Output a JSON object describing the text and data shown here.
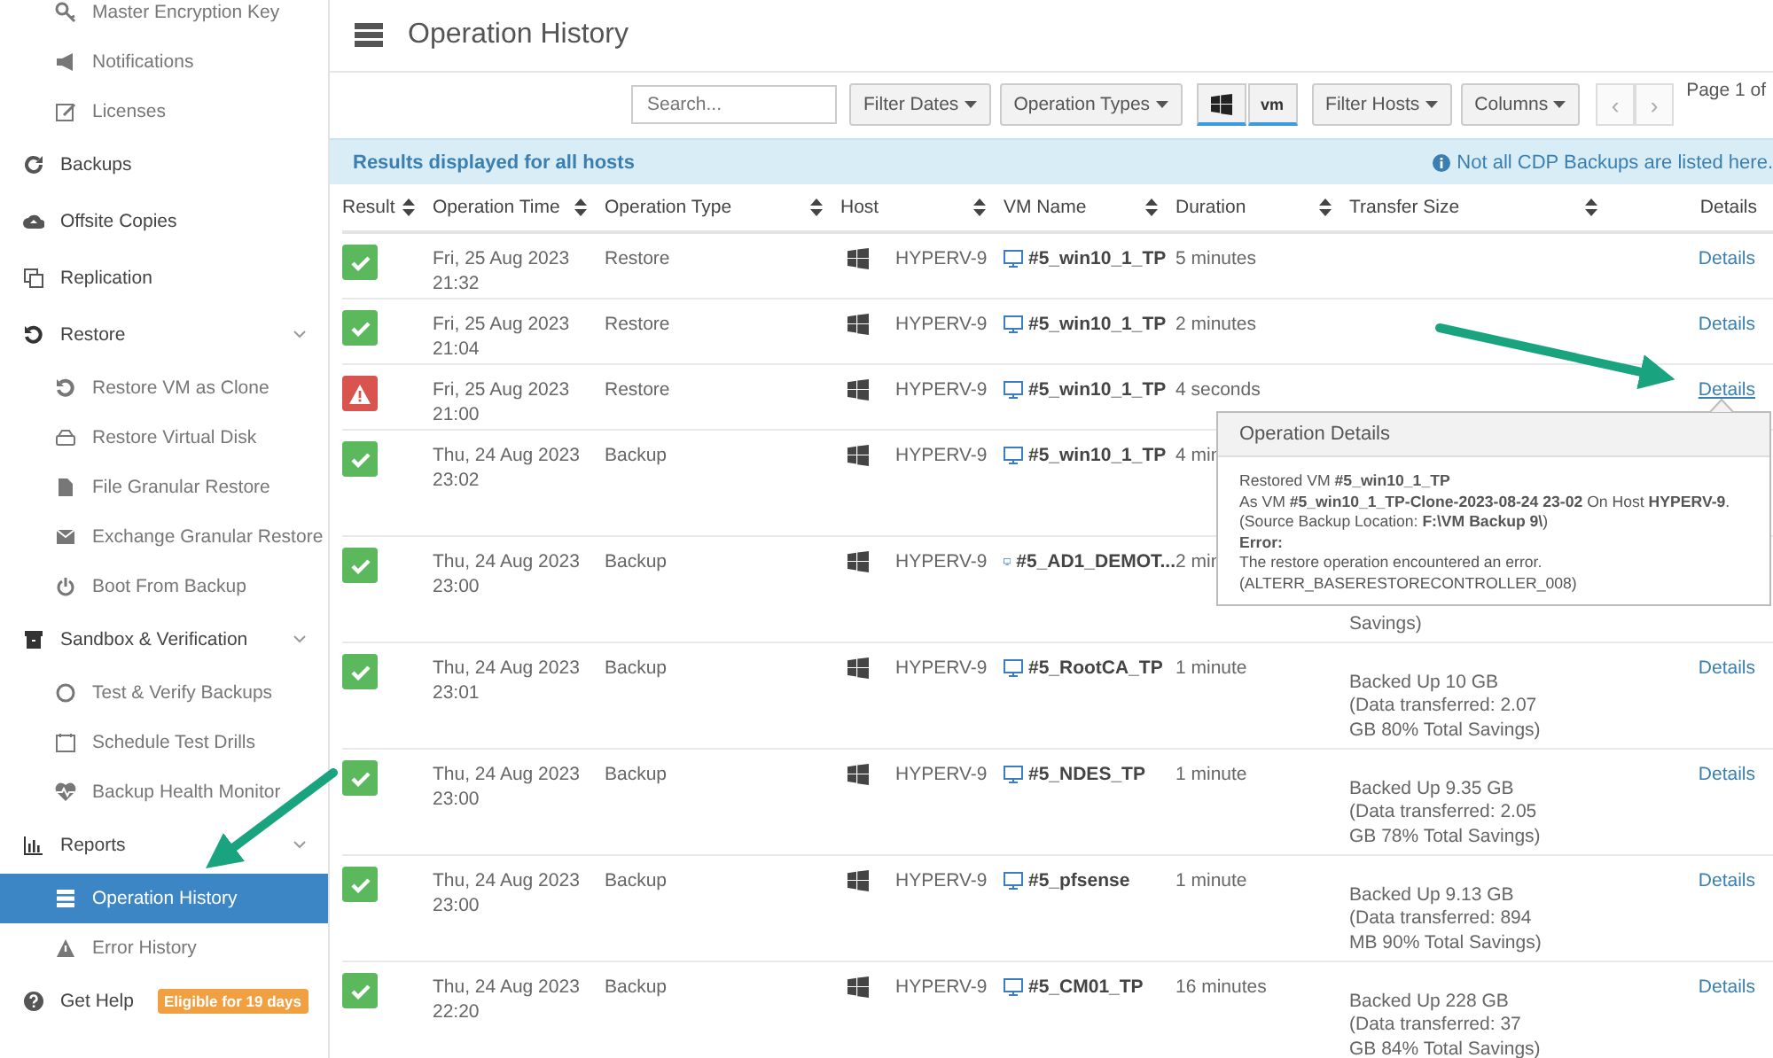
{
  "sidebar": {
    "settings_children": [
      {
        "label": "Master Encryption Key",
        "selected": false
      },
      {
        "label": "Notifications",
        "selected": false
      },
      {
        "label": "Licenses",
        "selected": false
      }
    ],
    "items": [
      {
        "label": "Backups",
        "selected": false
      },
      {
        "label": "Offsite Copies",
        "selected": false
      },
      {
        "label": "Replication",
        "selected": false
      },
      {
        "label": "Restore",
        "selected": false,
        "expanded": true,
        "children": [
          {
            "label": "Restore VM as Clone",
            "selected": false
          },
          {
            "label": "Restore Virtual Disk",
            "selected": false
          },
          {
            "label": "File Granular Restore",
            "selected": false
          },
          {
            "label": "Exchange Granular Restore",
            "selected": false
          },
          {
            "label": "Boot From Backup",
            "selected": false
          }
        ]
      },
      {
        "label": "Sandbox & Verification",
        "selected": false,
        "expanded": true,
        "children": [
          {
            "label": "Test & Verify Backups",
            "selected": false
          },
          {
            "label": "Schedule Test Drills",
            "selected": false
          },
          {
            "label": "Backup Health Monitor",
            "selected": false
          }
        ]
      },
      {
        "label": "Reports",
        "selected": false,
        "expanded": true,
        "children": [
          {
            "label": "Operation History",
            "selected": true
          },
          {
            "label": "Error History",
            "selected": false
          }
        ]
      },
      {
        "label": "Get Help",
        "selected": false,
        "badge": "Eligible for 19 days"
      }
    ]
  },
  "page": {
    "title": "Operation History"
  },
  "toolbar": {
    "search": {
      "placeholder": "Search..."
    },
    "filter_dates": "Filter Dates",
    "operation_types": "Operation Types",
    "platform_toggles": [
      {
        "kind": "windows",
        "selected": true
      },
      {
        "kind": "vmware",
        "label": "vm",
        "selected": true
      }
    ],
    "filter_hosts": "Filter Hosts",
    "columns": "Columns",
    "prev": "‹",
    "next": "›",
    "page_label": "Page 1 of"
  },
  "info_bar": {
    "message": "Results displayed for all hosts",
    "note": "Not all CDP Backups are listed here."
  },
  "table": {
    "columns": [
      {
        "label": "Result",
        "sortable": true
      },
      {
        "label": "Operation Time",
        "sortable": true
      },
      {
        "label": "Operation Type",
        "sortable": true
      },
      {
        "label": "Host",
        "sortable": true
      },
      {
        "label": "VM Name",
        "sortable": true
      },
      {
        "label": "Duration",
        "sortable": true
      },
      {
        "label": "Transfer Size",
        "sortable": true
      },
      {
        "label": "Details",
        "sortable": false
      }
    ],
    "rows": [
      {
        "succeeded": true,
        "time": "Fri, 25 Aug 2023 21:32",
        "type": "Restore",
        "host": "HYPERV-9",
        "vm": "#5_win10_1_TP",
        "duration": "5 minutes",
        "details": "Details"
      },
      {
        "succeeded": true,
        "time": "Fri, 25 Aug 2023 21:04",
        "type": "Restore",
        "host": "HYPERV-9",
        "vm": "#5_win10_1_TP",
        "duration": "2 minutes",
        "details": "Details"
      },
      {
        "succeeded": false,
        "time": "Fri, 25 Aug 2023 21:00",
        "type": "Restore",
        "host": "HYPERV-9",
        "vm": "#5_win10_1_TP",
        "duration": "4 seconds",
        "details": "Details"
      },
      {
        "succeeded": true,
        "time": "Thu, 24 Aug 2023 23:02",
        "type": "Backup",
        "host": "HYPERV-9",
        "vm": "#5_win10_1_TP",
        "duration": "4 min"
      },
      {
        "succeeded": true,
        "time": "Thu, 24 Aug 2023 23:00",
        "type": "Backup",
        "host": "HYPERV-9",
        "vm": "#5_AD1_DEMOT...",
        "duration": "2 min",
        "transfer": "Savings)"
      },
      {
        "succeeded": true,
        "time": "Thu, 24 Aug 2023 23:01",
        "type": "Backup",
        "host": "HYPERV-9",
        "vm": "#5_RootCA_TP",
        "duration": "1 minute",
        "transfer": "Backed Up 10 GB (Data transferred: 2.07 GB 80% Total Savings)",
        "details": "Details"
      },
      {
        "succeeded": true,
        "time": "Thu, 24 Aug 2023 23:00",
        "type": "Backup",
        "host": "HYPERV-9",
        "vm": "#5_NDES_TP",
        "duration": "1 minute",
        "transfer": "Backed Up 9.35 GB (Data transferred: 2.05 GB 78% Total Savings)",
        "details": "Details"
      },
      {
        "succeeded": true,
        "time": "Thu, 24 Aug 2023 23:00",
        "type": "Backup",
        "host": "HYPERV-9",
        "vm": "#5_pfsense",
        "duration": "1 minute",
        "transfer": "Backed Up 9.13 GB (Data transferred: 894 MB 90% Total Savings)",
        "details": "Details"
      },
      {
        "succeeded": true,
        "time": "Thu, 24 Aug 2023 22:20",
        "type": "Backup",
        "host": "HYPERV-9",
        "vm": "#5_CM01_TP",
        "duration": "16 minutes",
        "transfer": "Backed Up 228 GB (Data transferred: 37 GB 84% Total Savings)",
        "details": "Details"
      }
    ]
  },
  "popover": {
    "title": "Operation Details",
    "lines": [
      {
        "kind": "text",
        "text": "Restored VM **#5_win10_1_TP**"
      },
      {
        "kind": "text",
        "text": "As VM **#5_win10_1_TP-Clone-2023-08-24 23-02** On Host **HYPERV-9**."
      },
      {
        "kind": "text",
        "text": "(Source Backup Location: **F:\\VM Backup 9\\**)"
      },
      {
        "kind": "heading",
        "text": "Error:"
      },
      {
        "kind": "text",
        "text": "The restore operation encountered an error."
      },
      {
        "kind": "text",
        "text": "(ALTERR_BASERESTORECONTROLLER_008)"
      }
    ]
  }
}
